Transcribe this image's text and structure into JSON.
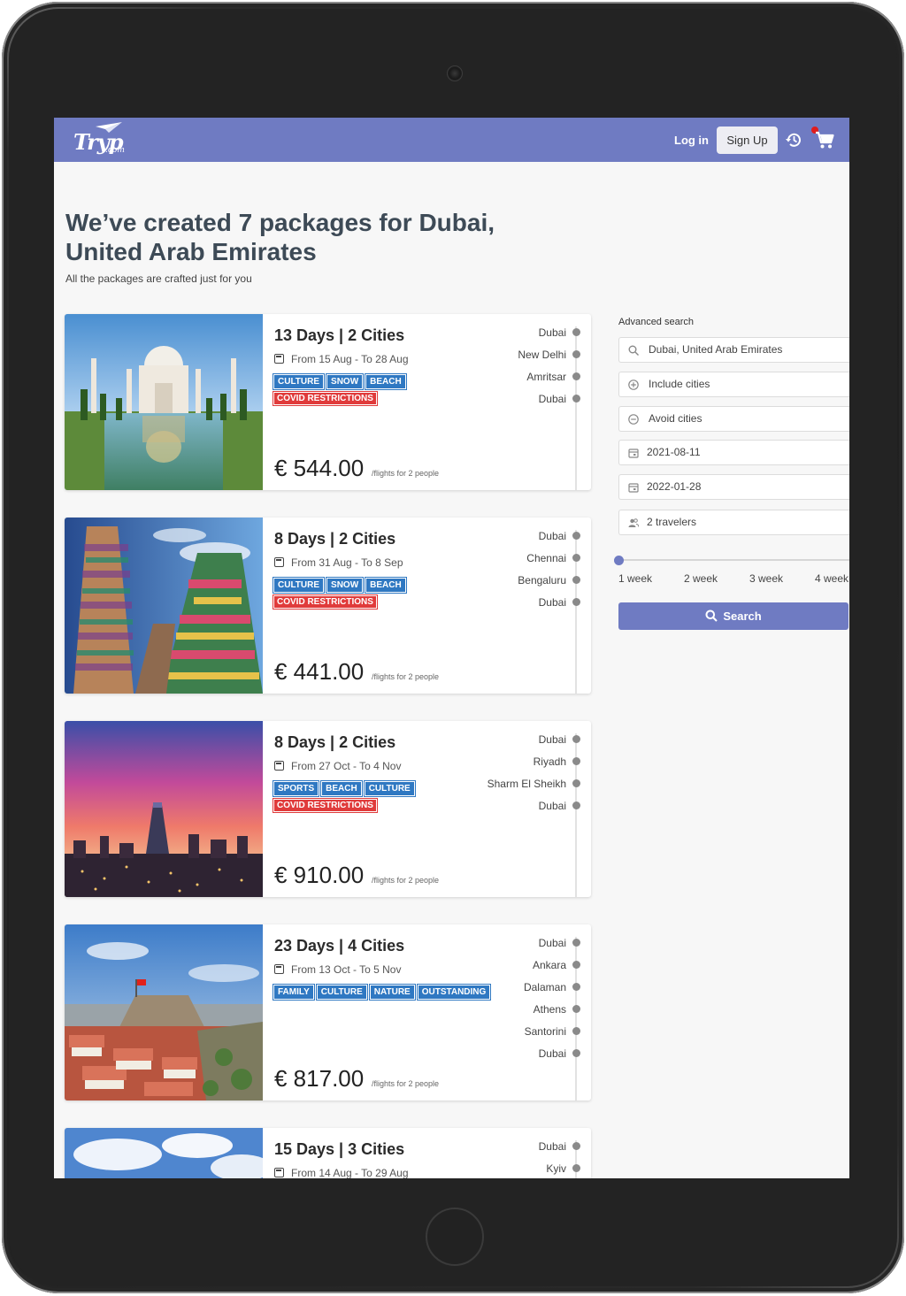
{
  "header": {
    "logo_main": "Tryp",
    "logo_sub": ".com",
    "login_label": "Log in",
    "signup_label": "Sign Up"
  },
  "hero": {
    "title": "We’ve created 7 packages for Dubai, United Arab Emirates",
    "subtitle": "All the packages are crafted just for you"
  },
  "packages": [
    {
      "title": "13 Days | 2 Cities",
      "dates": "From 15 Aug - To 28 Aug",
      "tags": [
        "CULTURE",
        "SNOW",
        "BEACH"
      ],
      "covid": "COVID RESTRICTIONS",
      "price": "€ 544.00",
      "price_note": "/flights for 2 people",
      "stops": [
        "Dubai",
        "New Delhi",
        "Amritsar",
        "Dubai"
      ]
    },
    {
      "title": "8 Days | 2 Cities",
      "dates": "From 31 Aug - To 8 Sep",
      "tags": [
        "CULTURE",
        "SNOW",
        "BEACH"
      ],
      "covid": "COVID RESTRICTIONS",
      "price": "€ 441.00",
      "price_note": "/flights for 2 people",
      "stops": [
        "Dubai",
        "Chennai",
        "Bengaluru",
        "Dubai"
      ]
    },
    {
      "title": "8 Days | 2 Cities",
      "dates": "From 27 Oct - To 4 Nov",
      "tags": [
        "SPORTS",
        "BEACH",
        "CULTURE"
      ],
      "covid": "COVID RESTRICTIONS",
      "price": "€ 910.00",
      "price_note": "/flights for 2 people",
      "stops": [
        "Dubai",
        "Riyadh",
        "Sharm El Sheikh",
        "Dubai"
      ]
    },
    {
      "title": "23 Days | 4 Cities",
      "dates": "From 13 Oct - To 5 Nov",
      "tags": [
        "FAMILY",
        "CULTURE",
        "NATURE",
        "OUTSTANDING"
      ],
      "covid": "",
      "price": "€ 817.00",
      "price_note": "/flights for 2 people",
      "stops": [
        "Dubai",
        "Ankara",
        "Dalaman",
        "Athens",
        "Santorini",
        "Dubai"
      ]
    },
    {
      "title": "15 Days | 3 Cities",
      "dates": "From 14 Aug - To 29 Aug",
      "tags": [],
      "covid": "",
      "price": "",
      "price_note": "",
      "stops": [
        "Dubai",
        "Kyiv"
      ]
    }
  ],
  "search": {
    "label": "Advanced search",
    "destination": "Dubai, United Arab Emirates",
    "include_placeholder": "Include cities",
    "avoid_placeholder": "Avoid cities",
    "start_date": "2021-08-11",
    "end_date": "2022-01-28",
    "travelers": "2 travelers",
    "duration_options": [
      "1 week",
      "2 week",
      "3 week",
      "4 week"
    ],
    "duration_selected_index": 0,
    "button_label": "Search"
  },
  "colors": {
    "brand": "#6f7bc2",
    "tag": "#2f78c2",
    "covid": "#e03b3b",
    "notification": "#e01d1d"
  }
}
